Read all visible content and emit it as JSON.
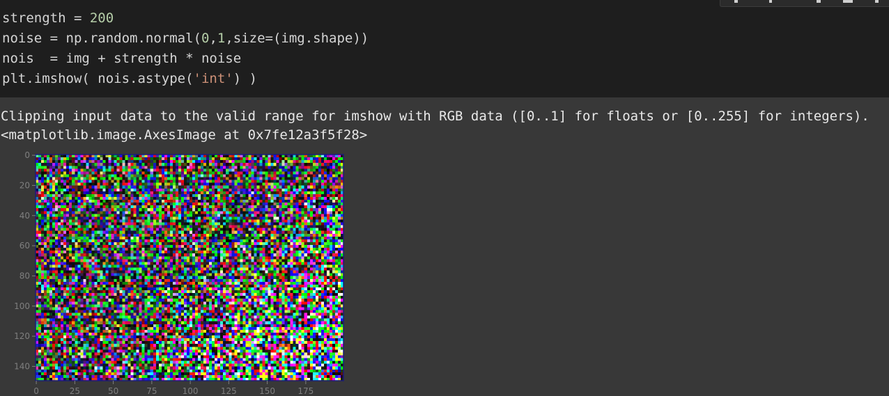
{
  "code_cell": {
    "lines": [
      [
        {
          "t": "strength = "
        },
        {
          "t": "200",
          "c": "num"
        }
      ],
      [
        {
          "t": "noise = np.random.normal("
        },
        {
          "t": "0",
          "c": "num"
        },
        {
          "t": ","
        },
        {
          "t": "1",
          "c": "num"
        },
        {
          "t": ",size=(img.shape))"
        }
      ],
      [
        {
          "t": "nois  = img + strength * noise"
        }
      ],
      [
        {
          "t": "plt.imshow( nois.astype("
        },
        {
          "t": "'int'",
          "c": "str"
        },
        {
          "t": ") )"
        }
      ]
    ]
  },
  "output": {
    "warning": "Clipping input data to the valid range for imshow with RGB data ([0..1] for floats or [0..255] for integers).",
    "repr": "<matplotlib.image.AxesImage at 0x7fe12a3f5f28>"
  },
  "image_plot": {
    "y_ticks": [
      "0",
      "20",
      "40",
      "60",
      "80",
      "100",
      "120",
      "140"
    ],
    "x_ticks": [
      "0",
      "25",
      "50",
      "75",
      "100",
      "125",
      "150",
      "175"
    ],
    "tick_values_y": [
      0,
      20,
      40,
      60,
      80,
      100,
      120,
      140
    ],
    "tick_values_x": [
      0,
      25,
      50,
      75,
      100,
      125,
      150,
      175
    ],
    "data_width": 200,
    "data_height": 150,
    "colors": {
      "frame": "#1b1b7a",
      "tick": "#7f7f7f"
    }
  }
}
